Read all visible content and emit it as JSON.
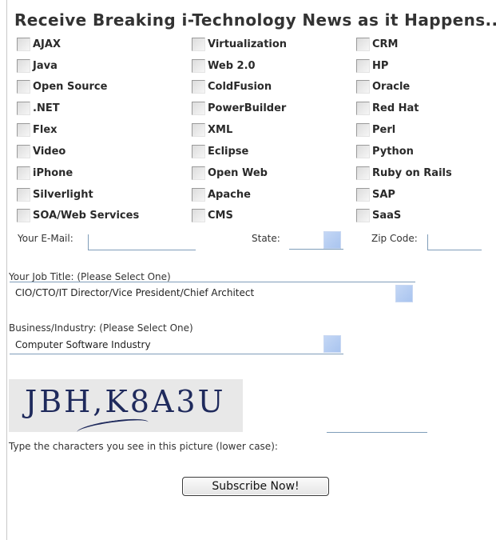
{
  "form": {
    "title": "Receive Breaking i-Technology News as it Happens...",
    "topics": [
      "AJAX",
      "Virtualization",
      "CRM",
      "Java",
      "Web 2.0",
      "HP",
      "Open Source",
      "ColdFusion",
      "Oracle",
      ".NET",
      "PowerBuilder",
      "Red Hat",
      "Flex",
      "XML",
      "Perl",
      "Video",
      "Eclipse",
      "Python",
      "iPhone",
      "Open Web",
      "Ruby on Rails",
      "Silverlight",
      "Apache",
      "SAP",
      "SOA/Web Services",
      "CMS",
      "SaaS"
    ],
    "email_label": "Your E-Mail:",
    "email_value": "",
    "state_label": "State:",
    "state_value": "",
    "zip_label": "Zip Code:",
    "zip_value": "",
    "job_title_label": "Your Job Title: (Please Select One)",
    "job_title_value": "CIO/CTO/IT Director/Vice President/Chief Architect",
    "industry_label": "Business/Industry: (Please Select One)",
    "industry_value": "Computer Software Industry",
    "captcha_text": "JBH,K8A3U",
    "captcha_answer": "",
    "captcha_instruction": "Type the characters you see in this picture (lower case):",
    "subscribe_label": "Subscribe Now!"
  }
}
